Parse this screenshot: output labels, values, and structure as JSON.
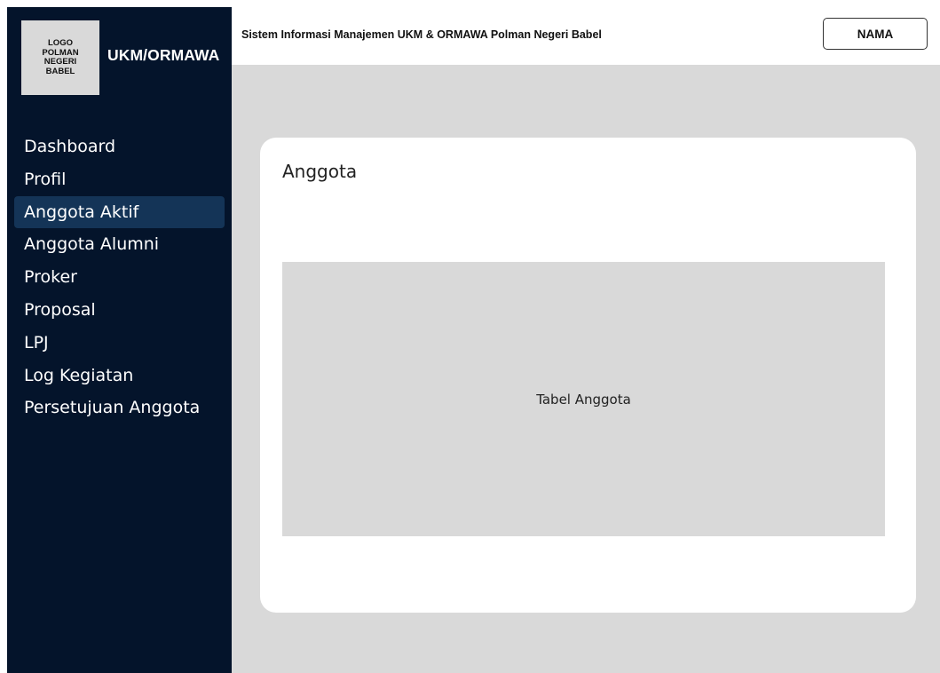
{
  "sidebar": {
    "logo_text": "LOGO\nPOLMAN\nNEGERI\nBABEL",
    "brand": "UKM/ORMAWA",
    "items": [
      {
        "label": "Dashboard",
        "active": false
      },
      {
        "label": "Profil",
        "active": false
      },
      {
        "label": "Anggota Aktif",
        "active": true
      },
      {
        "label": "Anggota Alumni",
        "active": false
      },
      {
        "label": "Proker",
        "active": false
      },
      {
        "label": "Proposal",
        "active": false
      },
      {
        "label": "LPJ",
        "active": false
      },
      {
        "label": "Log Kegiatan",
        "active": false
      },
      {
        "label": "Persetujuan Anggota",
        "active": false
      }
    ]
  },
  "header": {
    "title": "Sistem Informasi Manajemen UKM & ORMAWA Polman Negeri Babel",
    "user_button": "NAMA"
  },
  "main": {
    "card_title": "Anggota",
    "table_placeholder": "Tabel Anggota"
  },
  "colors": {
    "sidebar_bg": "#04142b",
    "sidebar_active": "#143457",
    "content_bg": "#d9d9d9",
    "card_bg": "#ffffff"
  }
}
